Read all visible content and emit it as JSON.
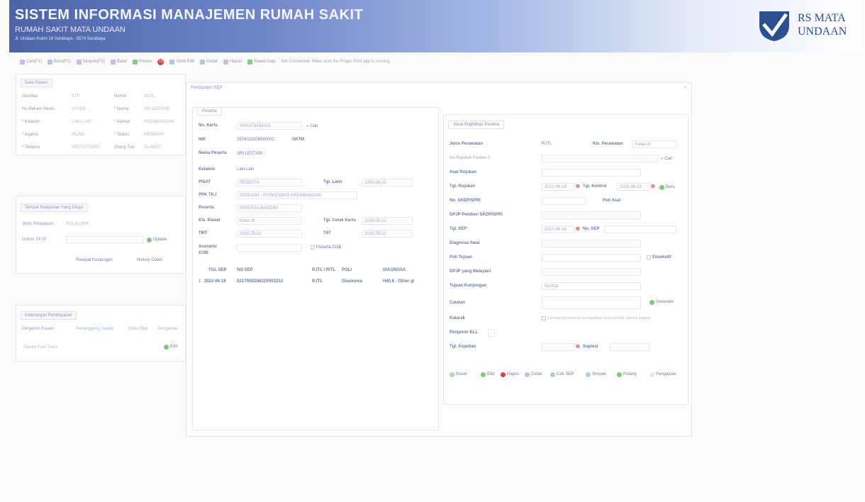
{
  "header": {
    "title": "SISTEM INFORMASI MANAJEMEN RUMAH SAKIT",
    "subtitle": "RUMAH SAKIT MATA UNDAAN",
    "address": "Jl. Undaan Kulon 19 Surabaya - 5574 Surabaya",
    "logo_line1": "RS MATA",
    "logo_line2": "UNDAAN"
  },
  "toolbar": {
    "items": [
      "Cari(F1)",
      "Baru(F2)",
      "Simpan(F3)",
      "Batal",
      "Proses",
      "Skrib Edit",
      "Cetak",
      "Hapus",
      "Rawat Inap"
    ],
    "badge": "12",
    "status": "Not Connected. Make sure the Finger Print app is running"
  },
  "patient_panel": {
    "tab": "Data Pasien",
    "rows": [
      {
        "label": "Identitas",
        "value": "KTP",
        "label2": "Nomor",
        "value2": "3578..."
      },
      {
        "label": "No.Rekam Medis",
        "value": "107425",
        "label2": "* Nama",
        "value2": "SRI LESTARI"
      },
      {
        "label": "* Kelamin",
        "value": "LAKI-LAKI",
        "label2": "* Alamat",
        "value2": "KREMBANGAN"
      },
      {
        "label": "* Agama",
        "value": "ISLAM",
        "label2": "* Status",
        "value2": "MENIKAH"
      },
      {
        "label": "* Telepon",
        "value": "085750702000",
        "label2": "Orang Tua",
        "value2": "SLAMET"
      }
    ]
  },
  "service_panel": {
    "tab": "Tempat Pelayanan Yang Dituju",
    "jenis_label": "Jenis Pelayanan",
    "jenis_value": "POLIKLINIK",
    "dokter_label": "Dokter DPJP",
    "update_label": "Update",
    "riwayat_label": "Riwayat Kunjungan",
    "history_label": "History Covid"
  },
  "payment_panel": {
    "tab": "Keterangan Pembayaran",
    "subtabs": [
      "Penjamin Pasien",
      "Penanggung Jawab",
      "Data Obat",
      "Pengantar"
    ],
    "row": "Pasien Fast Track",
    "btn": "Edit"
  },
  "dialog": {
    "title": "Pembuatan SEP",
    "peserta": {
      "legend": "Peserta",
      "fields": [
        {
          "label": "No. Kartu",
          "value": "0001476458313"
        },
        {
          "label": "NIK",
          "value": "3578011508590002",
          "extra": "SKTM"
        },
        {
          "label": "Nama Peserta",
          "value": "SRI LESTARI"
        },
        {
          "label": "Kelamin",
          "value": "Laki-Laki"
        },
        {
          "label": "PISAT",
          "value": "PESERTA",
          "label2": "Tgl. Lahir",
          "value2": "1959-08-15"
        },
        {
          "label": "PPK TK.I",
          "value": "0203U094 - PUSKESMAS KREMBANGAN"
        },
        {
          "label": "Peserta",
          "value": "PEKERJA MANDIRI"
        },
        {
          "label": "Kls. Rawat",
          "value": "Kelas III",
          "label2": "Tgl. Cetak Kartu",
          "value2": "2015-05-22"
        },
        {
          "label": "TMT",
          "value": "2015-05-22",
          "label2": "TAT",
          "value2": "2015-05-22"
        },
        {
          "label": "Asuransi COB",
          "value": "",
          "label2": "Peserta COB",
          "value2": ""
        }
      ],
      "cari": "Cari",
      "table_headers": [
        "TGL SEP",
        "NO SEP",
        "RJTL / RITL",
        "POLI",
        "DIAGNOSA"
      ],
      "table_rows": [
        {
          "no": "1",
          "tgl": "2022-06-18",
          "sep": "0217R0020622V003212",
          "jenis": "RJTL",
          "poli": "Glaukoma",
          "diag": "H40.8 : Other gl"
        }
      ]
    },
    "surat": {
      "legend": "Surat Eligibilitas Peserta",
      "fields": [
        {
          "label": "Jenis Perawatan",
          "value": "RJTL",
          "label2": "Kls. Perawatan",
          "value2": "Kelas III"
        },
        {
          "label": "No.Rujukan Faskes 2",
          "value": ""
        },
        {
          "label": "Asal Rujukan",
          "value": ""
        },
        {
          "label": "Tgl. Rujukan",
          "value": "2022-06-18",
          "label2": "Tgl. Kontrol",
          "value2": "2022-06-18"
        },
        {
          "label": "No. SKDP/SPRI",
          "value": "",
          "label2": "Poli Asal",
          "value2": ""
        },
        {
          "label": "DPJP Pemberi SKDP/SPRI",
          "value": ""
        },
        {
          "label": "Tgl. SEP",
          "value": "2022-06-18",
          "label2": "No. SEP",
          "value2": ""
        },
        {
          "label": "Diagnosa Awal",
          "value": ""
        },
        {
          "label": "Poli Tujuan",
          "value": "",
          "label2": "Eksekutif",
          "value2": ""
        },
        {
          "label": "DPJP yang Melayani",
          "value": ""
        },
        {
          "label": "Tujuan Kunjungan",
          "value": "Normal"
        },
        {
          "label": "Catatan",
          "value": ""
        },
        {
          "label": "Katarak",
          "value": "Centang jika peserta mendapatkan surat perintah operasi katarak"
        },
        {
          "label": "Penjamin KLL",
          "value": ""
        },
        {
          "label": "Tgl. Kejadian",
          "value": "",
          "label2": "Suplesi",
          "value2": ""
        }
      ],
      "cari": "Cari",
      "baru": "Baru",
      "generate": "Generate",
      "buttons": [
        "Reset",
        "Edit",
        "Hapus",
        "Cetak",
        "Cek SEP",
        "Simpan",
        "Pulang",
        "Pengajuan"
      ]
    }
  },
  "colors": {
    "header_start": "#4d63a8",
    "accent": "#2c4f8e",
    "green": "#4caf50",
    "red": "#d24545"
  }
}
